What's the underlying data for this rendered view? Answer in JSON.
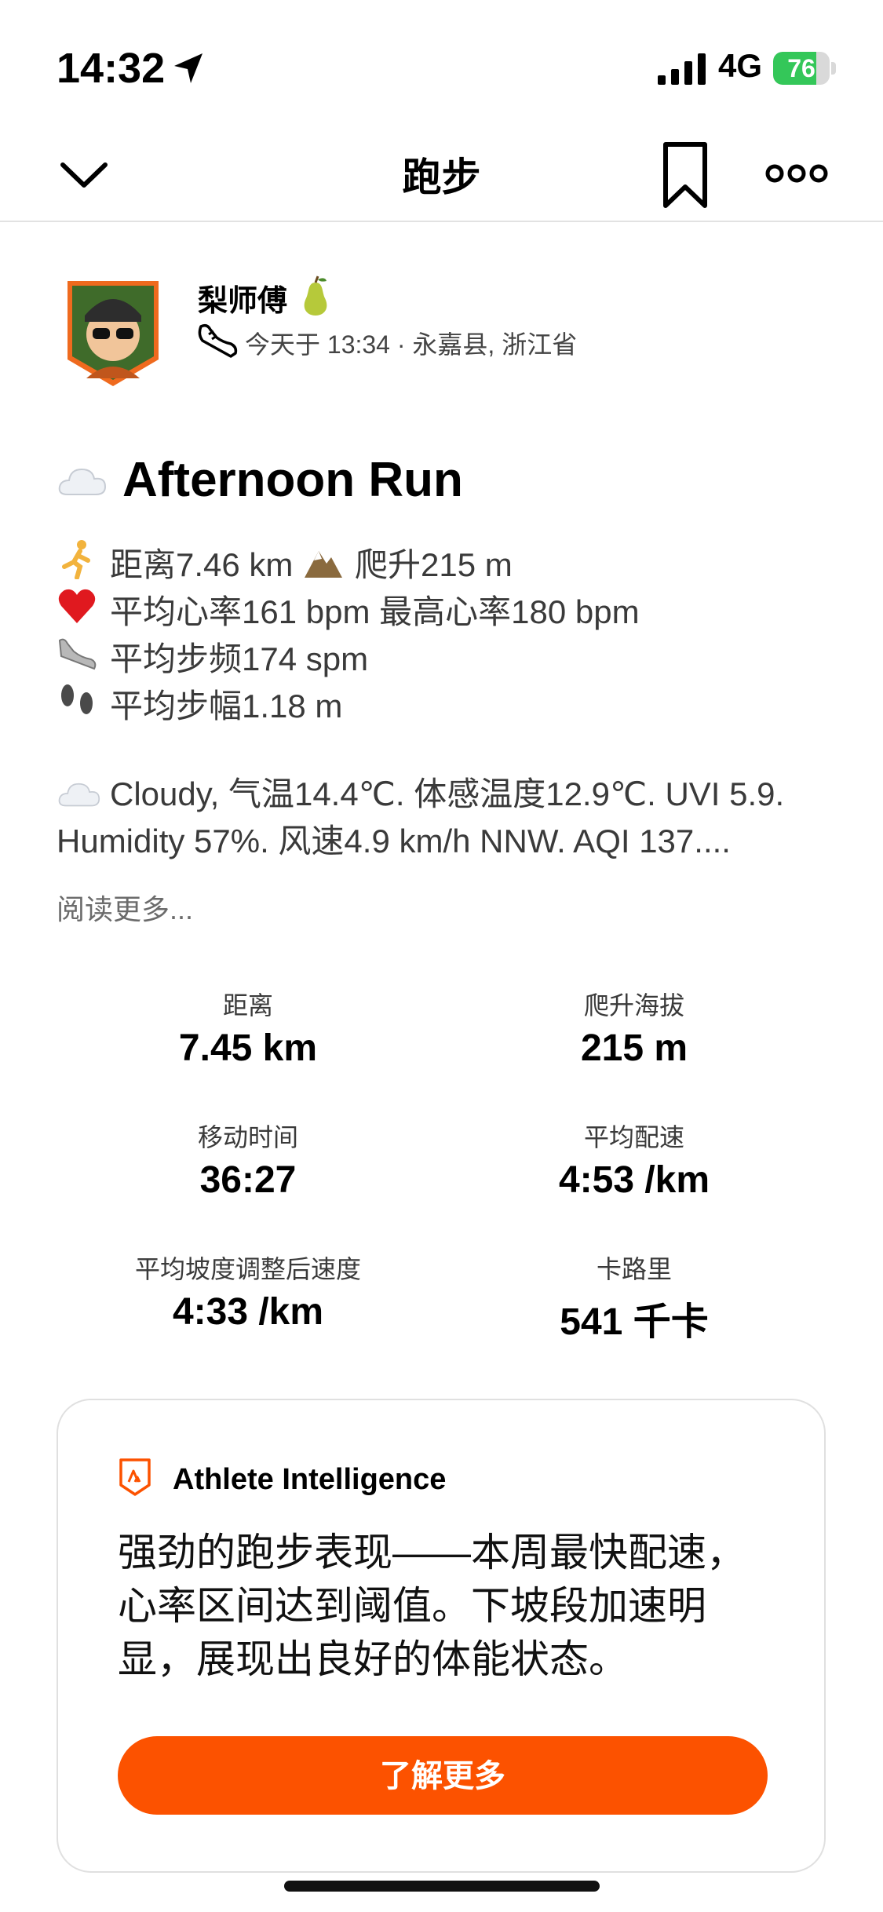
{
  "status_bar": {
    "time": "14:32",
    "network": "4G",
    "battery_text": "76",
    "battery_level": 0.76
  },
  "nav": {
    "title": "跑步"
  },
  "athlete": {
    "name": "梨师傅",
    "meta": "今天于 13:34 · 永嘉县, 浙江省"
  },
  "activity": {
    "title": "Afternoon Run",
    "desc_lines": [
      "距离7.46 km",
      "爬升215 m",
      "平均心率161 bpm 最高心率180 bpm",
      "平均步频174 spm",
      "平均步幅1.18 m"
    ],
    "weather_line1": "Cloudy, 气温14.4℃. 体感温度12.9℃. UVI 5.9.",
    "weather_line2": "Humidity 57%. 风速4.9 km/h NNW. AQI 137....",
    "read_more": "阅读更多..."
  },
  "stats": [
    {
      "label": "距离",
      "value": "7.45 km"
    },
    {
      "label": "爬升海拔",
      "value": "215 m"
    },
    {
      "label": "移动时间",
      "value": "36:27"
    },
    {
      "label": "平均配速",
      "value": "4:53 /km"
    },
    {
      "label": "平均坡度调整后速度",
      "value": "4:33 /km"
    },
    {
      "label": "卡路里",
      "value": "541 千卡"
    }
  ],
  "ai_card": {
    "title": "Athlete Intelligence",
    "summary": "强劲的跑步表现——本周最快配速，心率区间达到阈值。下坡段加速明显，展现出良好的体能状态。",
    "button_label": "了解更多"
  },
  "colors": {
    "brand": "#fc5200",
    "battery": "#34c759"
  },
  "icons": [
    "location-arrow-icon",
    "signal-icon",
    "battery-icon",
    "chevron-down-icon",
    "bookmark-icon",
    "more-icon",
    "pear-icon",
    "shoe-icon",
    "cloud-icon",
    "runner-icon",
    "mountain-icon",
    "heart-icon",
    "sneaker-icon",
    "footprints-icon",
    "strava-logo-icon"
  ]
}
